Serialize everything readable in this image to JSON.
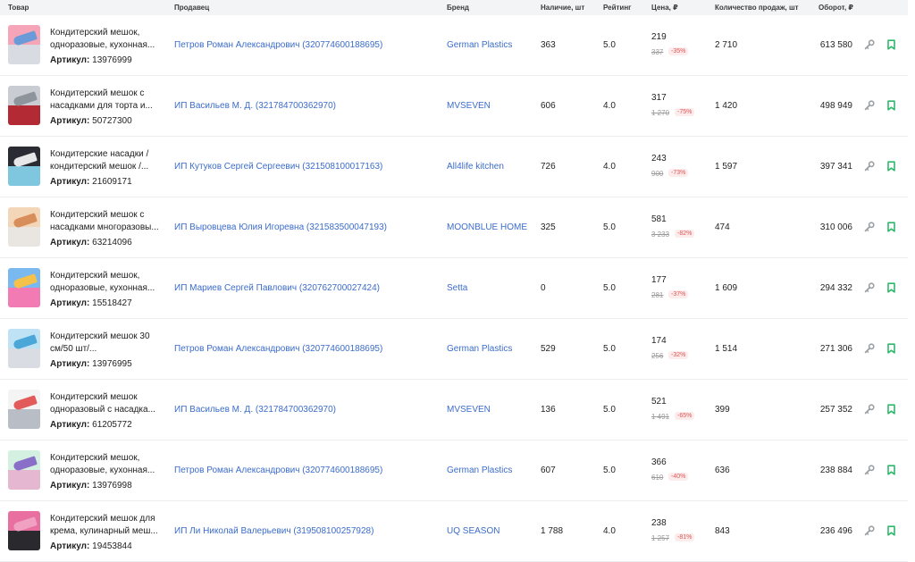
{
  "header": {
    "product": "Товар",
    "seller": "Продавец",
    "brand": "Бренд",
    "stock": "Наличие, шт",
    "rating": "Рейтинг",
    "price": "Цена, ₽",
    "sales": "Количество продаж, шт",
    "revenue": "Оборот, ₽"
  },
  "article_label": "Артикул:",
  "rows": [
    {
      "name1": "Кондитерский мешок,",
      "name2": "одноразовые, кухонная...",
      "article": "13976999",
      "seller": "Петров Роман Александрович (320774600188695)",
      "brand": "German Plastics",
      "stock": "363",
      "rating": "5.0",
      "price": "219",
      "old_price": "337",
      "discount": "-35%",
      "sales": "2 710",
      "revenue": "613 580",
      "thumb_top": "#f6a4b8",
      "thumb_bottom": "#d8dbe2",
      "tip": "#6a9bd8"
    },
    {
      "name1": "Кондитерский мешок с",
      "name2": "насадками для торта и...",
      "article": "50727300",
      "seller": "ИП Васильев М. Д. (321784700362970)",
      "brand": "MVSEVEN",
      "stock": "606",
      "rating": "4.0",
      "price": "317",
      "old_price": "1 270",
      "discount": "-75%",
      "sales": "1 420",
      "revenue": "498 949",
      "thumb_top": "#c9cdd3",
      "thumb_bottom": "#b42a34",
      "tip": "#8e949c"
    },
    {
      "name1": "Кондитерские насадки /",
      "name2": "кондитерский мешок /...",
      "article": "21609171",
      "seller": "ИП Кутуков Сергей Сергеевич (321508100017163)",
      "brand": "All4life kitchen",
      "stock": "726",
      "rating": "4.0",
      "price": "243",
      "old_price": "900",
      "discount": "-73%",
      "sales": "1 597",
      "revenue": "397 341",
      "thumb_top": "#2b2b33",
      "thumb_bottom": "#7fc7df",
      "tip": "#e7e7ea"
    },
    {
      "name1": "Кондитерский мешок с",
      "name2": "насадками многоразовы...",
      "article": "63214096",
      "seller": "ИП Выровцева Юлия Игоревна (321583500047193)",
      "brand": "MOONBLUE HOME",
      "stock": "325",
      "rating": "5.0",
      "price": "581",
      "old_price": "3 233",
      "discount": "-82%",
      "sales": "474",
      "revenue": "310 006",
      "thumb_top": "#f3d5b8",
      "thumb_bottom": "#e9e6e1",
      "tip": "#d88e5a"
    },
    {
      "name1": "Кондитерский мешок,",
      "name2": "одноразовые, кухонная...",
      "article": "15518427",
      "seller": "ИП Мариев Сергей Павлович (320762700027424)",
      "brand": "Setta",
      "stock": "0",
      "rating": "5.0",
      "price": "177",
      "old_price": "281",
      "discount": "-37%",
      "sales": "1 609",
      "revenue": "294 332",
      "thumb_top": "#7ab8f0",
      "thumb_bottom": "#f17bb2",
      "tip": "#f4c14a"
    },
    {
      "name1": "Кондитерский мешок 30",
      "name2": "см/50 шт/...",
      "article": "13976995",
      "seller": "Петров Роман Александрович (320774600188695)",
      "brand": "German Plastics",
      "stock": "529",
      "rating": "5.0",
      "price": "174",
      "old_price": "256",
      "discount": "-32%",
      "sales": "1 514",
      "revenue": "271 306",
      "thumb_top": "#bfe3f5",
      "thumb_bottom": "#d9dce3",
      "tip": "#4aa7d8"
    },
    {
      "name1": "Кондитерский мешок",
      "name2": "одноразовый с насадка...",
      "article": "61205772",
      "seller": "ИП Васильев М. Д. (321784700362970)",
      "brand": "MVSEVEN",
      "stock": "136",
      "rating": "5.0",
      "price": "521",
      "old_price": "1 491",
      "discount": "-65%",
      "sales": "399",
      "revenue": "257 352",
      "thumb_top": "#f4f4f4",
      "thumb_bottom": "#b9bec6",
      "tip": "#e25a5a"
    },
    {
      "name1": "Кондитерский мешок,",
      "name2": "одноразовые, кухонная...",
      "article": "13976998",
      "seller": "Петров Роман Александрович (320774600188695)",
      "brand": "German Plastics",
      "stock": "607",
      "rating": "5.0",
      "price": "366",
      "old_price": "610",
      "discount": "-40%",
      "sales": "636",
      "revenue": "238 884",
      "thumb_top": "#d4f0e0",
      "thumb_bottom": "#e6b7d0",
      "tip": "#8a6fc8"
    },
    {
      "name1": "Кондитерский мешок для",
      "name2": "крема, кулинарный меш...",
      "article": "19453844",
      "seller": "ИП Ли Николай Валерьевич (319508100257928)",
      "brand": "UQ SEASON",
      "stock": "1 788",
      "rating": "4.0",
      "price": "238",
      "old_price": "1 257",
      "discount": "-81%",
      "sales": "843",
      "revenue": "236 496",
      "thumb_top": "#e86fa0",
      "thumb_bottom": "#2a2a2e",
      "tip": "#f0a0c0"
    }
  ]
}
